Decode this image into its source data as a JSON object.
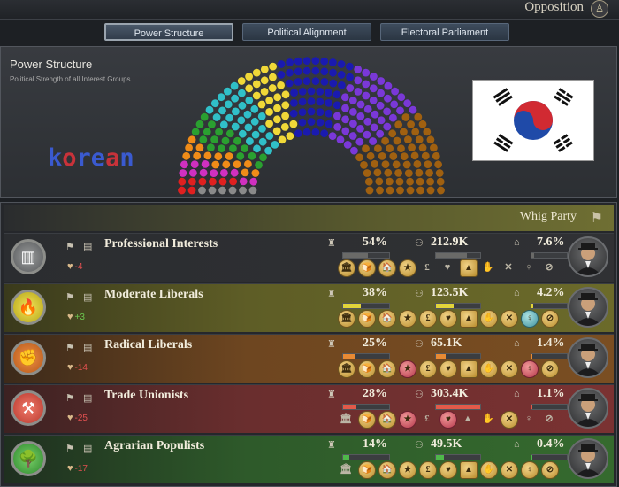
{
  "header": {
    "opposition_label": "Opposition"
  },
  "tabs": [
    {
      "label": "Power Structure",
      "active": true
    },
    {
      "label": "Political Alignment",
      "active": false
    },
    {
      "label": "Electoral Parliament",
      "active": false
    }
  ],
  "power_panel": {
    "title": "Power Structure",
    "subtitle": "Political Strength of all Interest Groups.",
    "overlay_text": "korean",
    "overlay_colors": [
      "#3a5ad0",
      "#c8323a",
      "#3a5ad0",
      "#3a5ad0",
      "#c8323a",
      "#3a5ad0"
    ]
  },
  "seat_colors": [
    "#8a8a8a",
    "#e02020",
    "#d030c0",
    "#f08c18",
    "#2aa030",
    "#30c0c8",
    "#f0d838",
    "#1a1ab0",
    "#7a38d8",
    "#a06010"
  ],
  "chart_data": {
    "type": "parliament_seats",
    "series": [
      {
        "color": "#8a8a8a",
        "seat_share": 0.02
      },
      {
        "color": "#e02020",
        "seat_share": 0.03
      },
      {
        "color": "#d030c0",
        "seat_share": 0.04
      },
      {
        "color": "#f08c18",
        "seat_share": 0.05
      },
      {
        "color": "#2aa030",
        "seat_share": 0.07
      },
      {
        "color": "#30c0c8",
        "seat_share": 0.11
      },
      {
        "color": "#f0d838",
        "seat_share": 0.1
      },
      {
        "color": "#1a1ab0",
        "seat_share": 0.18
      },
      {
        "color": "#7a38d8",
        "seat_share": 0.18
      },
      {
        "color": "#a06010",
        "seat_share": 0.22
      }
    ]
  },
  "party": {
    "name": "Whig Party"
  },
  "interest_groups": [
    {
      "name": "Professional Interests",
      "approval": "-4",
      "approval_color": "#e05050",
      "clout": "54%",
      "clout_value": 0.54,
      "pops": "212.9K",
      "pops_value": 0.7,
      "seats": "7.6%",
      "seats_value": 0.08,
      "bg": "linear-gradient(90deg,#2b2d30 0%,#303134 100%)",
      "emblem_bg": "radial-gradient(circle,#9a9c9c,#585a5c)",
      "emblem_icon": "▥",
      "bar_color": "#6a6a68"
    },
    {
      "name": "Moderate Liberals",
      "approval": "+3",
      "approval_color": "#6cc850",
      "clout": "38%",
      "clout_value": 0.38,
      "pops": "123.5K",
      "pops_value": 0.4,
      "seats": "4.2%",
      "seats_value": 0.05,
      "bg": "linear-gradient(90deg,#3a3a1c 0%,#5e5d26 40%,#6b6a2a 100%)",
      "emblem_bg": "radial-gradient(circle,#f3e35a,#b5a617)",
      "emblem_icon": "🔥",
      "bar_color": "#e2d43a"
    },
    {
      "name": "Radical Liberals",
      "approval": "-14",
      "approval_color": "#e05050",
      "clout": "25%",
      "clout_value": 0.25,
      "pops": "65.1K",
      "pops_value": 0.22,
      "seats": "1.4%",
      "seats_value": 0.02,
      "bg": "linear-gradient(90deg,#3c2a1a 0%,#6e4620 40%,#7a4e22 100%)",
      "emblem_bg": "radial-gradient(circle,#f09048,#b55818)",
      "emblem_icon": "✊",
      "bar_color": "#e88a34"
    },
    {
      "name": "Trade Unionists",
      "approval": "-25",
      "approval_color": "#e05050",
      "clout": "28%",
      "clout_value": 0.28,
      "pops": "303.4K",
      "pops_value": 1.0,
      "seats": "1.1%",
      "seats_value": 0.015,
      "bg": "linear-gradient(90deg,#3c2222 0%,#6a2e2e 40%,#7a3232 100%)",
      "emblem_bg": "radial-gradient(circle,#f07a6a,#b8392e)",
      "emblem_icon": "⚒",
      "bar_color": "#e25a4a"
    },
    {
      "name": "Agrarian Populists",
      "approval": "-17",
      "approval_color": "#e05050",
      "clout": "14%",
      "clout_value": 0.14,
      "pops": "49.5K",
      "pops_value": 0.17,
      "seats": "0.4%",
      "seats_value": 0.005,
      "bg": "linear-gradient(90deg,#1f2f1f 0%,#2e5a2a 40%,#356a2e 100%)",
      "emblem_bg": "radial-gradient(circle,#7ad06a,#2e8a2e)",
      "emblem_icon": "🌳",
      "bar_color": "#4fb84a"
    }
  ],
  "trait_rows": [
    [
      "gold:🏛",
      "gold:🍞",
      "gold:🏠",
      "gold:★",
      "dim:£",
      "dim:♥",
      "gold:▲",
      "dim:✋",
      "dim:✕",
      "dim:♀",
      "dim:⊘"
    ],
    [
      "gold:🏛",
      "gold:🍞",
      "gold:🏠",
      "gold:★",
      "gold:£",
      "gold:♥",
      "gold:▲",
      "gold:✋",
      "gold:✕",
      "teal:♀",
      "gold:⊘"
    ],
    [
      "gold:🏛",
      "gold:🍞",
      "gold:🏠",
      "red:★",
      "gold:£",
      "gold:♥",
      "gold:▲",
      "gold:✋",
      "gold:✕",
      "red:♀",
      "gold:⊘"
    ],
    [
      "dim:🏛",
      "gold:🍞",
      "gold:🏠",
      "red:★",
      "dim:£",
      "red:♥",
      "dim:▲",
      "dim:✋",
      "gold:✕",
      "dim:♀",
      "dim:⊘"
    ],
    [
      "dim:🏛",
      "gold:🍞",
      "gold:🏠",
      "gold:★",
      "gold:£",
      "gold:♥",
      "gold:▲",
      "gold:✋",
      "gold:✕",
      "gold:♀",
      "gold:⊘"
    ]
  ]
}
